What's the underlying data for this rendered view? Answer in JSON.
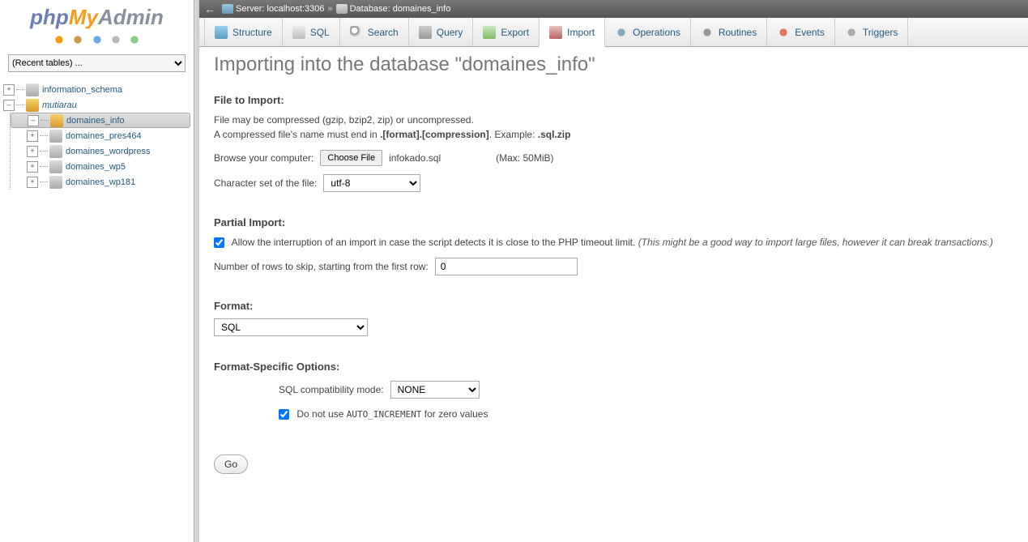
{
  "logo": {
    "php": "php",
    "my": "My",
    "admin": "Admin"
  },
  "recent_tables": "(Recent tables) ...",
  "tree": {
    "db1": "information_schema",
    "db2": "mutiarau",
    "children": [
      "domaines_info",
      "domaines_pres464",
      "domaines_wordpress",
      "domaines_wp5",
      "domaines_wp181"
    ]
  },
  "breadcrumb": {
    "server_label": "Server: localhost:3306",
    "db_label": "Database: domaines_info",
    "sep": "»"
  },
  "tabs": [
    "Structure",
    "SQL",
    "Search",
    "Query",
    "Export",
    "Import",
    "Operations",
    "Routines",
    "Events",
    "Triggers"
  ],
  "heading": "Importing into the database \"domaines_info\"",
  "file_to_import": {
    "title": "File to Import:",
    "desc1": "File may be compressed (gzip, bzip2, zip) or uncompressed.",
    "desc2a": "A compressed file's name must end in ",
    "desc2b": ".[format].[compression]",
    "desc2c": ". Example: ",
    "desc2d": ".sql.zip",
    "browse_label": "Browse your computer:",
    "choose_btn": "Choose File",
    "file_name": "infokado.sql",
    "max": "(Max: 50MiB)",
    "charset_label": "Character set of the file:",
    "charset_value": "utf-8"
  },
  "partial_import": {
    "title": "Partial Import:",
    "cb_label": "Allow the interruption of an import in case the script detects it is close to the PHP timeout limit. ",
    "cb_note": "(This might be a good way to import large files, however it can break transactions.)",
    "skip_label": "Number of rows to skip, starting from the first row:",
    "skip_value": "0"
  },
  "format": {
    "title": "Format:",
    "value": "SQL"
  },
  "fso": {
    "title": "Format-Specific Options:",
    "compat_label": "SQL compatibility mode:",
    "compat_value": "NONE",
    "ai_label_a": "Do not use ",
    "ai_label_b": "AUTO_INCREMENT",
    "ai_label_c": " for zero values"
  },
  "go": "Go"
}
